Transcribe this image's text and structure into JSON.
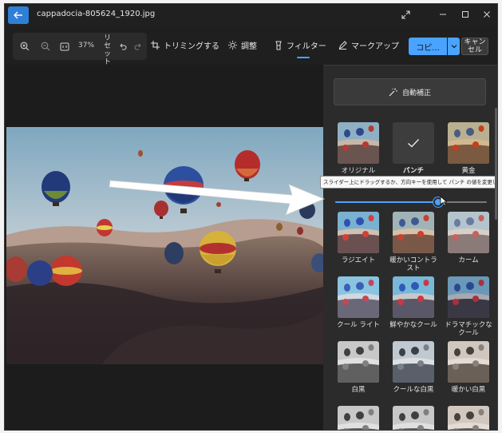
{
  "window": {
    "title": "cappadocia-805624_1920.jpg"
  },
  "toolbar": {
    "zoom_percent": "37%",
    "reset_label": "リセット",
    "crop_label": "トリミングする",
    "adjust_label": "調整",
    "filter_label": "フィルター",
    "markup_label": "マークアップ",
    "copy_label": "コピ...",
    "cancel_label": "キャンセル"
  },
  "panel": {
    "auto_label": "自動補正",
    "tooltip": "スライダー上にドラッグするか、方向キーを使用して パンチ の値を変更します",
    "slider_value": 0.68,
    "filters": [
      {
        "label": "オリジナル",
        "tone": "normal",
        "selected": false
      },
      {
        "label": "パンチ",
        "tone": "punch",
        "selected": true
      },
      {
        "label": "黄金",
        "tone": "golden",
        "selected": false
      },
      {
        "label": "ラジエイト",
        "tone": "radiate",
        "selected": false
      },
      {
        "label": "暖かいコントラスト",
        "tone": "warm",
        "selected": false
      },
      {
        "label": "カーム",
        "tone": "calm",
        "selected": false
      },
      {
        "label": "クール ライト",
        "tone": "coollight",
        "selected": false
      },
      {
        "label": "鮮やかなクール",
        "tone": "vivid",
        "selected": false
      },
      {
        "label": "ドラマチックなクール",
        "tone": "dramatic",
        "selected": false
      },
      {
        "label": "白黒",
        "tone": "bw",
        "selected": false
      },
      {
        "label": "クールな白黒",
        "tone": "coolbw",
        "selected": false
      },
      {
        "label": "暖かい白黒",
        "tone": "warmbw",
        "selected": false
      },
      {
        "label": "",
        "tone": "bw",
        "selected": false
      },
      {
        "label": "",
        "tone": "bw",
        "selected": false
      },
      {
        "label": "",
        "tone": "warmbw",
        "selected": false
      }
    ]
  },
  "colors": {
    "accent": "#4aa3ff",
    "window_bg": "#1f1f1f",
    "panel_bg": "#2b2b2b"
  }
}
